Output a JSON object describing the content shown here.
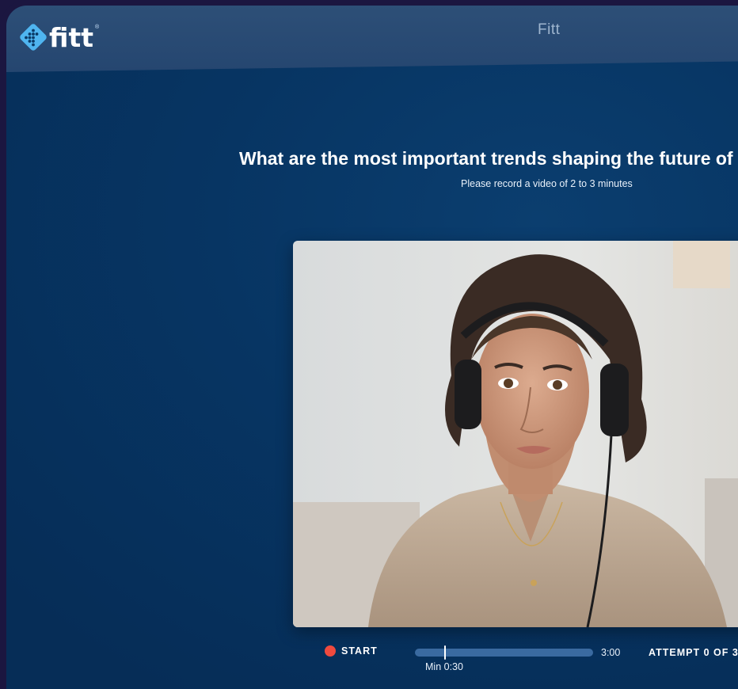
{
  "header": {
    "logo_text": "fitt",
    "logo_mark": "®",
    "title": "Fitt"
  },
  "question": {
    "text": "What are the most important trends shaping the future of your industry?",
    "instructions": "Please record a video of 2 to 3 minutes"
  },
  "video": {
    "subject": "webcam-preview"
  },
  "controls": {
    "start_label": "START",
    "min_label": "Min 0:30",
    "max_time": "3:00",
    "attempt_label": "ATTEMPT 0 OF 3",
    "progress_fraction": 0,
    "min_fraction": 0.1667
  },
  "colors": {
    "record": "#f04a3e",
    "background": "#073563",
    "topbar": "#2d4f77",
    "track": "#3a6aa0"
  },
  "icons": {
    "logo": "diamond-grid-icon",
    "record": "record-dot-icon"
  }
}
